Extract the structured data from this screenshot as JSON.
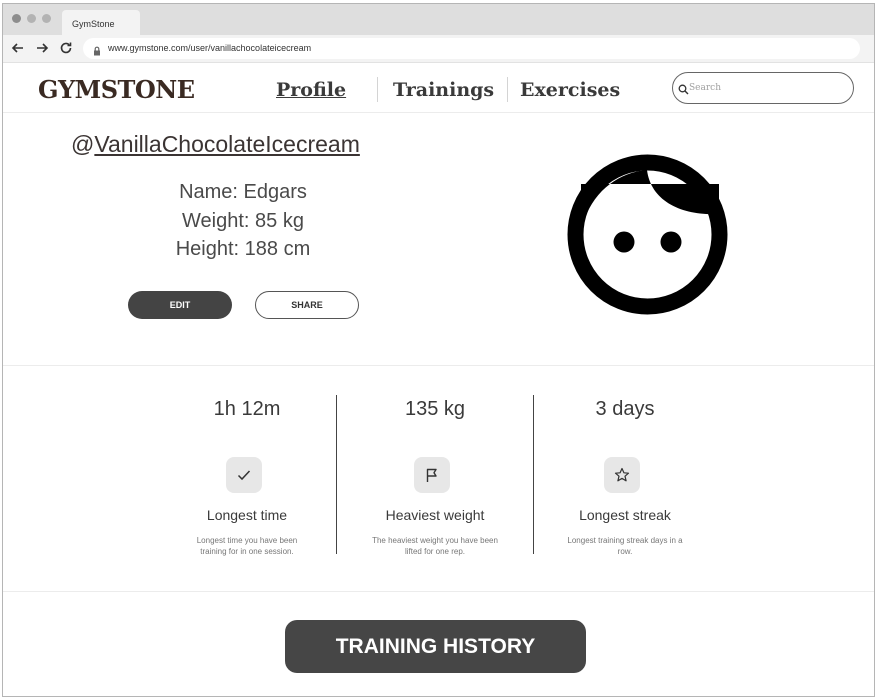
{
  "browser": {
    "tab_title": "GymStone",
    "url": "www.gymstone.com/user/vanillachocolateicecream"
  },
  "header": {
    "logo": "GYMSTONE",
    "nav": {
      "profile": "Profile",
      "trainings": "Trainings",
      "exercises": "Exercises"
    },
    "search_placeholder": "Search"
  },
  "profile": {
    "at": "@",
    "username": "VanillaChocolateIcecream",
    "name_line": "Name: Edgars",
    "weight_line": "Weight: 85 kg",
    "height_line": "Height: 188 cm",
    "edit_label": "EDIT",
    "share_label": "SHARE",
    "avatar_icon": "face-avatar-icon"
  },
  "stats": [
    {
      "value": "1h 12m",
      "icon": "check-icon",
      "title": "Longest time",
      "description": "Longest time you have been training for in one session."
    },
    {
      "value": "135 kg",
      "icon": "flag-icon",
      "title": "Heaviest weight",
      "description": "The heaviest weight you have been lifted for one rep."
    },
    {
      "value": "3 days",
      "icon": "star-icon",
      "title": "Longest streak",
      "description": "Longest training streak days in a row."
    }
  ],
  "history_button": "TRAINING HISTORY",
  "colors": {
    "dark_button": "#444444",
    "logo": "#3a2a22",
    "icon_box": "#e7e7e7"
  }
}
